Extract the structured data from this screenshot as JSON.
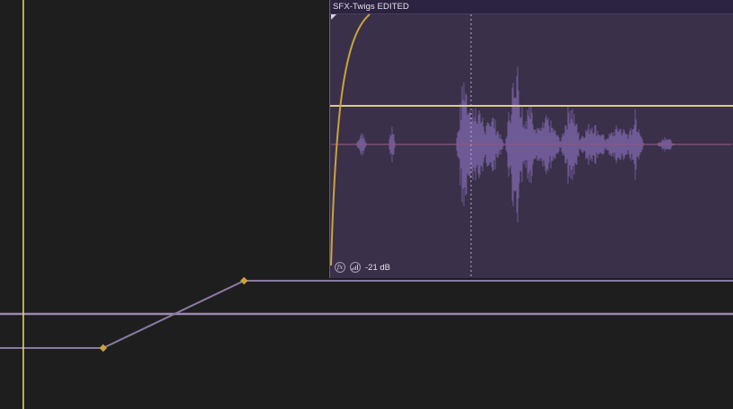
{
  "clip": {
    "title": "SFX-Twigs EDITED",
    "fx_icon_label": "fx",
    "gain_label": "-21 dB"
  },
  "colors": {
    "background": "#1e1e1e",
    "clip_body": "#3a3049",
    "clip_header": "#2c2340",
    "waveform": "#6e5a95",
    "playhead": "#e6e05a",
    "volume_envelope": "#d6cd8c",
    "fade_curve": "#c8a53c",
    "center_line": "#b0506c",
    "track_envelope": "#8c7aa2",
    "envelope_point": "#c8a53c"
  },
  "icons": {
    "fx": "fx-icon",
    "gain": "gain-icon",
    "fade_marker": "fade-in-marker-icon"
  }
}
